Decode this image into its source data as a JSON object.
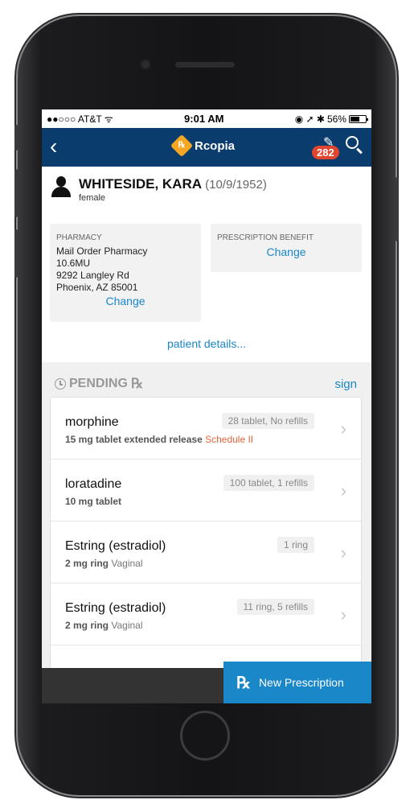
{
  "status_bar": {
    "carrier": "●●○○○ AT&T ᯤ",
    "time": "9:01 AM",
    "right_icons": "◉ ➚ ✱ ",
    "battery": "56%"
  },
  "nav": {
    "back_icon": "back-chevron-icon",
    "brand": "Rcopia",
    "badge_count": "282"
  },
  "patient": {
    "name": "WHITESIDE, KARA",
    "dob": "(10/9/1952)",
    "sex": "female"
  },
  "pharmacy": {
    "label": "PHARMACY",
    "name": "Mail Order Pharmacy",
    "line2": "10.6MU",
    "address": "9292 Langley Rd",
    "city": "Phoenix, AZ 85001",
    "change_label": "Change"
  },
  "benefit": {
    "label": "PRESCRIPTION BENEFIT",
    "change_label": "Change"
  },
  "patient_details_link": "patient details...",
  "pending": {
    "title": "PENDING",
    "rx_glyph": "℞",
    "sign_label": "sign",
    "items": [
      {
        "name": "morphine",
        "detail": "15 mg tablet extended release",
        "extra": "Schedule II",
        "qty": "28 tablet, No refills"
      },
      {
        "name": "loratadine",
        "detail": "10 mg tablet",
        "extra": "",
        "qty": "100 tablet, 1 refills"
      },
      {
        "name": "Estring (estradiol)",
        "detail": "2 mg ring",
        "extra": "Vaginal",
        "qty": "1 ring"
      },
      {
        "name": "Estring (estradiol)",
        "detail": "2 mg ring",
        "extra": "Vaginal",
        "qty": "11 ring, 5 refills"
      }
    ]
  },
  "new_prescription": {
    "icon": "℞",
    "label": "New Prescription"
  },
  "colors": {
    "nav": "#0a3d6e",
    "link": "#1a87c9",
    "badge": "#e0452f",
    "schedule": "#e8643a"
  }
}
